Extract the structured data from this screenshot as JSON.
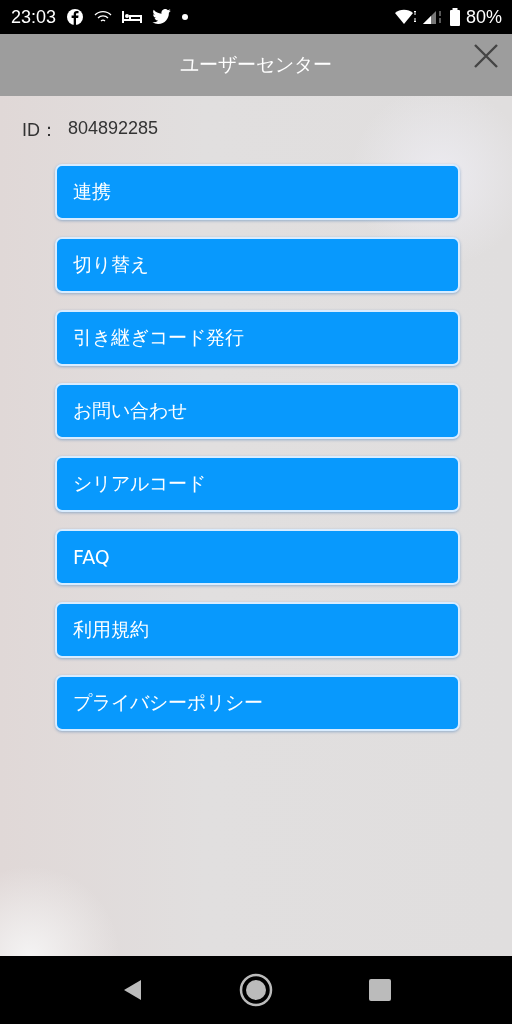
{
  "status_bar": {
    "time": "23:03",
    "battery": "80%"
  },
  "header": {
    "title": "ユーザーセンター"
  },
  "user": {
    "id_label": "ID：",
    "id_value": "804892285"
  },
  "menu": [
    {
      "label": "連携"
    },
    {
      "label": "切り替え"
    },
    {
      "label": "引き継ぎコード発行"
    },
    {
      "label": "お問い合わせ"
    },
    {
      "label": "シリアルコード"
    },
    {
      "label": "FAQ"
    },
    {
      "label": "利用規約"
    },
    {
      "label": "プライバシーポリシー"
    }
  ]
}
